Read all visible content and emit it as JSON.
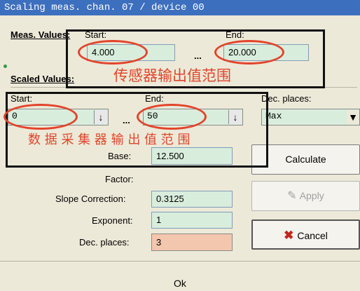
{
  "window": {
    "title": "Scaling meas. chan. 07 / device 00"
  },
  "meas_values": {
    "heading": "Meas. Values:",
    "start_label": "Start:",
    "end_label": "End:",
    "start_value": "4.000",
    "end_value": "20.000",
    "ellipsis": "..."
  },
  "annotation_top": "传感器输出值范围",
  "scaled_values": {
    "heading": "Scaled Values:",
    "start_label": "Start:",
    "end_label": "End:",
    "start_value": "0",
    "end_value": "50",
    "ellipsis": "..."
  },
  "dec_places": {
    "label": "Dec. places:",
    "value": "Max"
  },
  "annotation_bottom": "数 据 采 集 器 输 出 值 范 围",
  "params": {
    "base_label": "Base:",
    "base_value": "12.500",
    "factor_label": "Factor:",
    "slope_label": "Slope Correction:",
    "slope_value": "0.3125",
    "exponent_label": "Exponent:",
    "exponent_value": "1",
    "dec_label": "Dec. places:",
    "dec_value": "3"
  },
  "buttons": {
    "calculate": "Calculate",
    "apply": "Apply",
    "cancel": "Cancel",
    "ok": "Ok"
  },
  "colors": {
    "annotation": "#e2442b",
    "field": "#d9eddc",
    "dec_field": "#f3c7ad"
  }
}
